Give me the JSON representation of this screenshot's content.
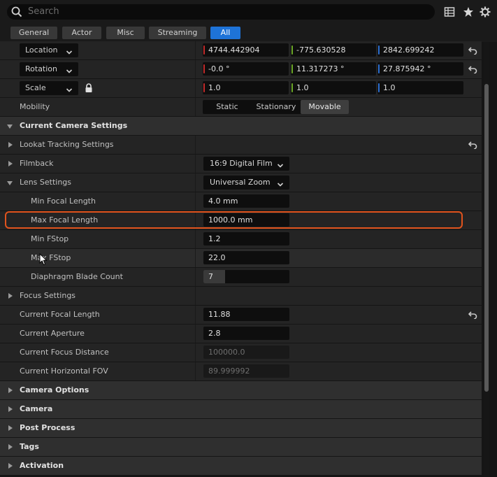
{
  "search": {
    "placeholder": "Search"
  },
  "toolbar_icons": [
    "table-view-icon",
    "star-icon",
    "gear-icon"
  ],
  "filter_tabs": [
    {
      "label": "General",
      "active": false
    },
    {
      "label": "Actor",
      "active": false
    },
    {
      "label": "Misc",
      "active": false
    },
    {
      "label": "Streaming",
      "active": false
    },
    {
      "label": "All",
      "active": true
    }
  ],
  "transform": {
    "location": {
      "label": "Location",
      "x": "4744.442904",
      "y": "-775.630528",
      "z": "2842.699242"
    },
    "rotation": {
      "label": "Rotation",
      "x": "-0.0 °",
      "y": "11.317273 °",
      "z": "27.875942 °"
    },
    "scale": {
      "label": "Scale",
      "x": "1.0",
      "y": "1.0",
      "z": "1.0"
    },
    "mobility": {
      "label": "Mobility",
      "options": [
        "Static",
        "Stationary",
        "Movable"
      ],
      "selected": "Movable"
    }
  },
  "current_camera_settings": {
    "title": "Current Camera Settings",
    "lookat": "Lookat Tracking Settings",
    "filmback": {
      "label": "Filmback",
      "value": "16:9 Digital Film"
    },
    "lens": {
      "label": "Lens Settings",
      "value": "Universal Zoom"
    },
    "min_focal": {
      "label": "Min Focal Length",
      "value": "4.0 mm"
    },
    "max_focal": {
      "label": "Max Focal Length",
      "value": "1000.0 mm"
    },
    "min_fstop": {
      "label": "Min FStop",
      "value": "1.2"
    },
    "max_fstop": {
      "label": "Max FStop",
      "value": "22.0"
    },
    "blade_count": {
      "label": "Diaphragm Blade Count",
      "value": "7",
      "fill_fraction": 0.25
    },
    "focus": "Focus Settings",
    "current_focal": {
      "label": "Current Focal Length",
      "value": "11.88"
    },
    "aperture": {
      "label": "Current Aperture",
      "value": "2.8"
    },
    "focus_distance": {
      "label": "Current Focus Distance",
      "value": "100000.0"
    },
    "fov": {
      "label": "Current Horizontal FOV",
      "value": "89.999992"
    }
  },
  "categories": [
    "Camera Options",
    "Camera",
    "Post Process",
    "Tags",
    "Activation"
  ],
  "colors": {
    "accent": "#1e73d8",
    "highlight": "#e0531d",
    "x_axis": "#c22a2a",
    "y_axis": "#6aa626",
    "z_axis": "#2c6fd1"
  }
}
